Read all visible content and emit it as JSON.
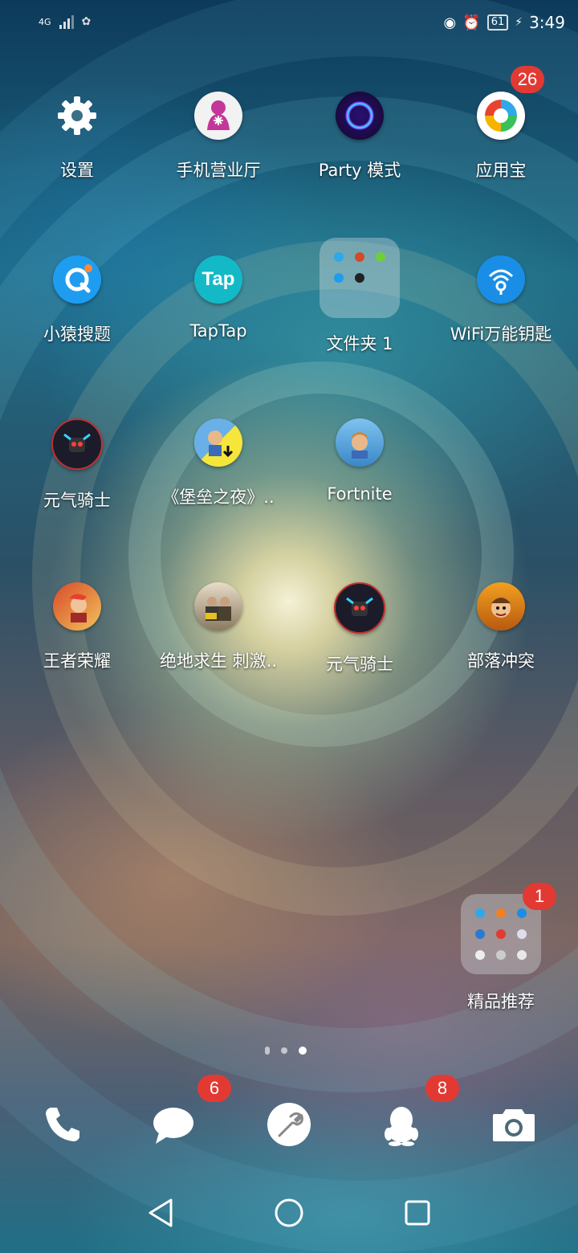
{
  "status_bar": {
    "network": "4G",
    "time": "3:49",
    "battery": "61"
  },
  "apps": [
    {
      "label": "设置",
      "badge": ""
    },
    {
      "label": "手机营业厅",
      "badge": ""
    },
    {
      "label": "Party 模式",
      "badge": ""
    },
    {
      "label": "应用宝",
      "badge": "26"
    },
    {
      "label": "小猿搜题",
      "badge": ""
    },
    {
      "label": "TapTap",
      "badge": "",
      "icon_text": "Tap"
    },
    {
      "label": "文件夹 1",
      "badge": ""
    },
    {
      "label": "WiFi万能钥匙",
      "badge": ""
    },
    {
      "label": "元气骑士",
      "badge": ""
    },
    {
      "label": "《堡垒之夜》..",
      "badge": ""
    },
    {
      "label": "Fortnite",
      "badge": ""
    },
    {
      "label": "王者荣耀",
      "badge": ""
    },
    {
      "label": "绝地求生 刺激..",
      "badge": ""
    },
    {
      "label": "元气骑士",
      "badge": ""
    },
    {
      "label": "部落冲突",
      "badge": ""
    },
    {
      "label": "精品推荐",
      "badge": "1"
    }
  ],
  "dock": {
    "messages_badge": "6",
    "qq_badge": "8"
  },
  "colors": {
    "badge": "#e23a33",
    "tap_teal": "#14b9c8",
    "wifi_blue": "#1a8ee6",
    "party_purple": "#5b2fd6"
  }
}
